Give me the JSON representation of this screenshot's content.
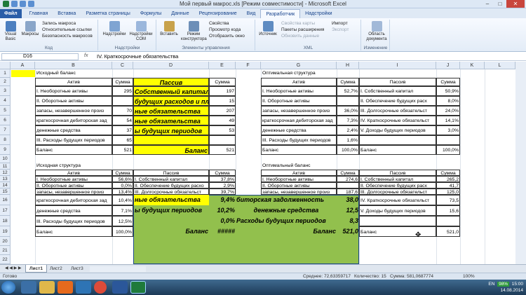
{
  "window": {
    "title": "Мой первый макрос.xls [Режим совместимости] - Microsoft Excel",
    "controls": [
      "–",
      "□",
      "✕"
    ]
  },
  "tabs": [
    "Файл",
    "Главная",
    "Вставка",
    "Разметка страницы",
    "Формулы",
    "Данные",
    "Рецензирование",
    "Вид",
    "Разработчик",
    "Надстройки"
  ],
  "active_tab": "Разработчик",
  "ribbon": {
    "code_group": {
      "name": "Код",
      "visual_basic": "Visual Basic",
      "macros": "Макросы",
      "record_macro": "Запись макроса",
      "relative_refs": "Относительные ссылки",
      "macro_security": "Безопасность макросов"
    },
    "addins_group": {
      "name": "Надстройки",
      "addins": "Надстройки",
      "com_addins": "Надстройки COM"
    },
    "controls_group": {
      "name": "Элементы управления",
      "insert": "Вставить",
      "design_mode": "Режим конструктора",
      "properties": "Свойства",
      "view_code": "Просмотр кода",
      "run_dialog": "Отобразить окно"
    },
    "xml_group": {
      "name": "XML",
      "source": "Источник",
      "map_props": "Свойства карты",
      "expansion_packs": "Пакеты расширения",
      "refresh_data": "Обновить данные",
      "import": "Импорт",
      "export": "Экспорт"
    },
    "modify_group": {
      "name": "Изменение",
      "doc_panel": "Область документа"
    }
  },
  "formula_bar": {
    "name_box": "D16",
    "fx": "fx",
    "content": "IV. Краткосрочные обязательства"
  },
  "columns": [
    "A",
    "B",
    "C",
    "D",
    "E",
    "F",
    "G",
    "H",
    "I",
    "J",
    "K",
    "L"
  ],
  "rows": [
    "1",
    "2",
    "3",
    "4",
    "5",
    "6",
    "7",
    "8",
    "9",
    "10",
    "11",
    "12",
    "13",
    "14",
    "15",
    "16",
    "17",
    "18",
    "19",
    "20",
    "21",
    "22"
  ],
  "cells": {
    "b1": "Исходный баланс",
    "b2": "Актив",
    "c2": "Сумма",
    "d2": "Пассив",
    "e2": "Сумма",
    "b3": "I. Необоротные активы",
    "c3": "295",
    "d3": "Собственный капитал",
    "e3": "197",
    "b4": "II. Оборотные активы",
    "c4": "",
    "d4": "будущих расходов и платежей",
    "e4": "15",
    "b5": "запасы, незавершенное произ",
    "c5": "70",
    "d5": "ные обязательства",
    "e5": "207",
    "b6": "краткосрочная дебиторская зад",
    "c6": "54",
    "d6": "ные обязательства",
    "e6": "49",
    "b7": "денежные средства",
    "c7": "37",
    "d7": "ы будущих периодов",
    "e7": "53",
    "b8": "III. Расходы будущих периодов",
    "c8": "65",
    "b9": "Баланс",
    "c9": "521",
    "d9": "Баланс",
    "e9": "521",
    "g1": "Оптимальная структура",
    "g2": "Актив",
    "h2": "Сумма",
    "i2": "Пассив",
    "j2": "Сумма",
    "g3": "I. Необоротные активы",
    "h3": "52,7%",
    "i3": "I. Собственный капитал",
    "j3": "50,9%",
    "g4": "II. Оборотные активы",
    "h4": "",
    "i4": "II. Обеспечение будущих расх",
    "j4": "8,0%",
    "g5": "запасы, незавершенное произ",
    "h5": "36,0%",
    "i5": "III. Долгосрочные обязательст",
    "j5": "24,0%",
    "g6": "краткосрочная дебиторская зад",
    "h6": "7,3%",
    "i6": "IV. Краткосрочные обязательст",
    "j6": "14,1%",
    "g7": "денежные средства",
    "h7": "2,4%",
    "i7": "V. Доходы будущих периодов",
    "j7": "3,0%",
    "g8": "III. Расходы будущих периодов",
    "h8": "1,6%",
    "g9": "Баланс",
    "h9": "100,0%",
    "i9": "Баланс",
    "j9": "100,0%",
    "b11": "Исходная структура",
    "b12": "Актив",
    "c12": "Сумма",
    "d12": "Пассив",
    "e12": "Сумма",
    "b13": "I. Необоротные активы",
    "c13": "56,6%",
    "d13": "I. Собственный капитал",
    "e13": "37,8%",
    "b14": "II. Оборотные активы",
    "c14": "0,0%",
    "d14": "II. Обеспечение будущих расхо",
    "e14": "2,9%",
    "b15": "запасы, незавершенное произ",
    "c15": "13,4%",
    "d15": "III. Долгосрочные обязательст",
    "e15": "39,7%",
    "b16": "краткосрочная дебиторская зад",
    "c16": "10,4%",
    "d16": "ные обязательства",
    "e16": "9,4%",
    "b17": "денежные средства",
    "c17": "7,1%",
    "d17": "ы будущих периодов",
    "e17": "10,2%",
    "b18": "III. Расходы будущих периодов",
    "c18": "12,5%",
    "e18": "0,0%",
    "b19": "Баланс",
    "c19": "100,0%",
    "d19": "Баланс",
    "e19": "#####",
    "g11": "Оптимальный баланс",
    "g12": "Актив",
    "h12": "Сумма",
    "i12": "Пассив",
    "j12": "Сумма",
    "g13": "I. Необоротные активы",
    "h13": "274,6",
    "i13": "I. Собственный капитал",
    "j13": "265,2",
    "g14": "II. Оборотные активы",
    "h14": "",
    "i14": "II. Обеспечение будущих расх",
    "j14": "41,7",
    "g15": "запасы, незавершенное произ",
    "h15": "187,6",
    "i15": "III. Долгосрочные обязательст",
    "j15": "125,0",
    "fg16": "биторская задолженность",
    "h16": "38,0",
    "i16": "IV. Краткосрочные обязательст",
    "j16": "73,5",
    "fg17": "денежные средства",
    "h17": "12,5",
    "i17": "V. Доходы будущих периодов",
    "j17": "15,6",
    "fg18": "Расходы будущих периодов",
    "h18": "8,3",
    "fg19": "Баланс",
    "h19": "521,0",
    "i19": "Баланс",
    "j19": "521,0"
  },
  "sheet_tabs": [
    "Лист1",
    "Лист2",
    "Лист3"
  ],
  "active_sheet": "Лист1",
  "status": {
    "ready": "Готово",
    "average": "Среднее: 72,63359717",
    "count": "Количество: 15",
    "sum": "Сумма: 581,0687774",
    "zoom": "100%"
  },
  "taskbar": {
    "lang": "EN",
    "battery": "98%",
    "time": "15:00",
    "date": "14.08.2014"
  },
  "colors": {
    "yellow": "#ffff00",
    "green": "#92c04d",
    "file_tab": "#2a5ea8"
  }
}
